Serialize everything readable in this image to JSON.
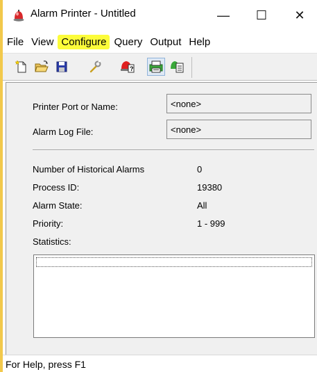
{
  "window": {
    "title": "Alarm Printer - Untitled",
    "controls": {
      "minimize": "—",
      "maximize": "☐",
      "close": "✕"
    }
  },
  "menu": {
    "items": [
      {
        "label": "File",
        "highlighted": false
      },
      {
        "label": "View",
        "highlighted": false
      },
      {
        "label": "Configure",
        "highlighted": true
      },
      {
        "label": "Query",
        "highlighted": false
      },
      {
        "label": "Output",
        "highlighted": false
      },
      {
        "label": "Help",
        "highlighted": false
      }
    ],
    "highlight_color": "#fcfc3a"
  },
  "toolbar": {
    "buttons": [
      {
        "icon": "new-file-icon"
      },
      {
        "icon": "open-folder-icon"
      },
      {
        "icon": "save-disk-icon"
      },
      {
        "icon": "wrench-icon"
      },
      {
        "icon": "alarm-query-icon"
      },
      {
        "icon": "printer-output-icon",
        "pressed": true
      },
      {
        "icon": "log-file-icon"
      }
    ]
  },
  "form": {
    "printer_port_label": "Printer Port or Name:",
    "printer_port_value": "<none>",
    "alarm_log_label": "Alarm Log File:",
    "alarm_log_value": "<none>"
  },
  "info": {
    "historical_label": "Number of Historical Alarms",
    "historical_value": "0",
    "process_id_label": "Process ID:",
    "process_id_value": "19380",
    "alarm_state_label": "Alarm State:",
    "alarm_state_value": "All",
    "priority_label": "Priority:",
    "priority_value": "1 - 999",
    "statistics_label": "Statistics:"
  },
  "status": {
    "text": "For Help, press F1"
  }
}
